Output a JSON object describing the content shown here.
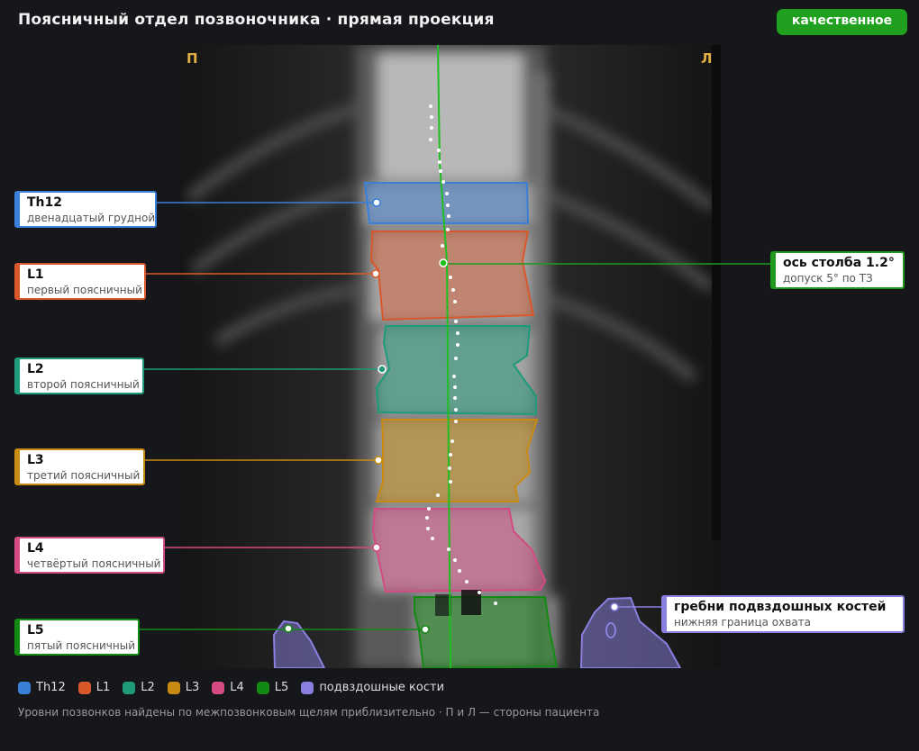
{
  "header": {
    "title": "Поясничный отдел позвоночника · прямая проекция",
    "badge": "качественное"
  },
  "viewer": {
    "orient_left": "П",
    "orient_right": "Л"
  },
  "labels": {
    "th12": {
      "title": "Th12",
      "sub": "двенадцатый грудной",
      "color": "#3a7fd8"
    },
    "l1": {
      "title": "L1",
      "sub": "первый поясничный",
      "color": "#d9582b"
    },
    "l2": {
      "title": "L2",
      "sub": "второй поясничный",
      "color": "#1f9a7a"
    },
    "l3": {
      "title": "L3",
      "sub": "третий поясничный",
      "color": "#c88a10"
    },
    "l4": {
      "title": "L4",
      "sub": "четвёртый поясничный",
      "color": "#d44a82"
    },
    "l5": {
      "title": "L5",
      "sub": "пятый поясничный",
      "color": "#138a13"
    },
    "axis": {
      "title": "ось столба 1.2°",
      "sub": "допуск 5° по ТЗ",
      "color": "#1f9a1f"
    },
    "iliac": {
      "title": "гребни подвздошных костей",
      "sub": "нижняя граница охвата",
      "color": "#8a80e0"
    }
  },
  "legend": [
    {
      "name": "Th12",
      "color": "#3a7fd8"
    },
    {
      "name": "L1",
      "color": "#d9582b"
    },
    {
      "name": "L2",
      "color": "#1f9a7a"
    },
    {
      "name": "L3",
      "color": "#c88a10"
    },
    {
      "name": "L4",
      "color": "#d44a82"
    },
    {
      "name": "L5",
      "color": "#138a13"
    },
    {
      "name": "подвздошные кости",
      "color": "#8a80e0"
    }
  ],
  "footer": "Уровни позвонков найдены по межпозвонковым щелям приблизительно · П и Л — стороны пациента"
}
